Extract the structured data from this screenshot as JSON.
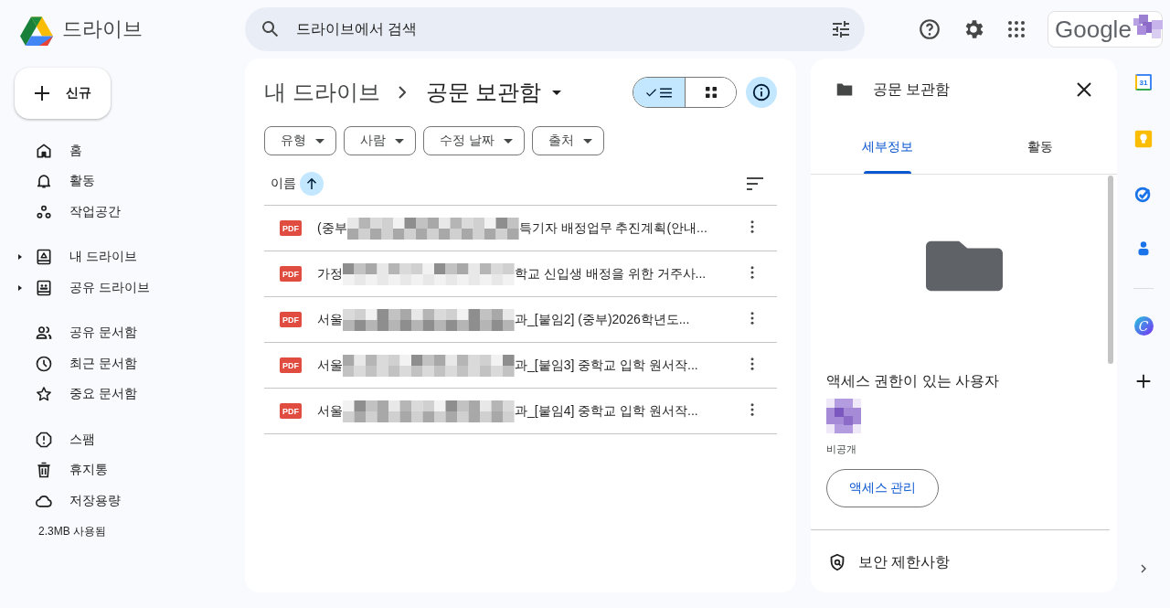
{
  "header": {
    "app_name": "드라이브",
    "search": {
      "placeholder": "드라이브에서 검색"
    },
    "account_label": "Google"
  },
  "sidebar": {
    "new_button": "신규",
    "groups": [
      [
        {
          "kind": "home",
          "label": "홈"
        },
        {
          "kind": "activity",
          "label": "활동"
        },
        {
          "kind": "workspaces",
          "label": "작업공간"
        }
      ],
      [
        {
          "kind": "my-drive",
          "label": "내 드라이브",
          "expanded": false
        },
        {
          "kind": "shared-drives",
          "label": "공유 드라이브",
          "expanded": false
        }
      ],
      [
        {
          "kind": "shared",
          "label": "공유 문서함"
        },
        {
          "kind": "recent",
          "label": "최근 문서함"
        },
        {
          "kind": "starred",
          "label": "중요 문서함"
        }
      ],
      [
        {
          "kind": "spam",
          "label": "스팸"
        },
        {
          "kind": "trash",
          "label": "휴지통"
        },
        {
          "kind": "storage",
          "label": "저장용량"
        }
      ]
    ],
    "storage_used": "2.3MB 사용됨"
  },
  "main": {
    "breadcrumb": [
      "내 드라이브",
      "공문 보관함"
    ],
    "view_toggle": [
      {
        "kind": "list",
        "selected": true
      },
      {
        "kind": "grid",
        "selected": false
      }
    ],
    "details_open": true,
    "filters": [
      "유형",
      "사람",
      "수정 날짜",
      "출처"
    ],
    "name_column": {
      "label": "이름",
      "sorted_ascending": true
    },
    "files": [
      {
        "icon_label": "PDF",
        "name_start": "(중부",
        "name_end": "특기자 배정업무 추진계획(안내..."
      },
      {
        "icon_label": "PDF",
        "name_start": "가정",
        "name_end": "학교 신입생 배정을 위한 거주사..."
      },
      {
        "icon_label": "PDF",
        "name_start": "서울",
        "name_end": "과_[붙임2] (중부)2026학년도..."
      },
      {
        "icon_label": "PDF",
        "name_start": "서울",
        "name_end": "과_[붙임3] 중학교 입학 원서작..."
      },
      {
        "icon_label": "PDF",
        "name_start": "서울",
        "name_end": "과_[붙임4] 중학교 입학 원서작..."
      }
    ]
  },
  "details": {
    "title": "공문 보관함",
    "tabs": [
      {
        "label": "세부정보",
        "selected": true
      },
      {
        "label": "활동",
        "selected": false
      }
    ],
    "access_heading": "액세스 권한이 있는 사용자",
    "access_user_label": "비공개",
    "manage_button": "액세스 관리",
    "security": "보안 제한사항"
  },
  "app_rail": [
    {
      "kind": "calendar",
      "label": "31"
    },
    {
      "kind": "keep"
    },
    {
      "kind": "tasks"
    },
    {
      "kind": "contacts"
    },
    {
      "kind": "canva",
      "label": "C"
    },
    {
      "kind": "add"
    }
  ]
}
